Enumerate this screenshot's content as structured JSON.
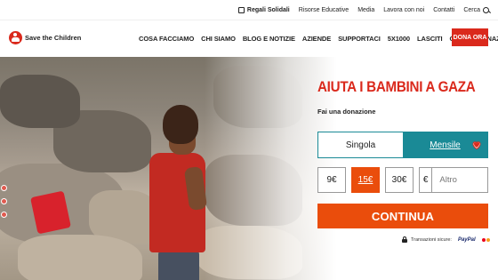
{
  "topbar": {
    "items": [
      "Regali Solidali",
      "Risorse Educative",
      "Media",
      "Lavora con noi",
      "Contatti",
      "Cerca"
    ]
  },
  "brand": {
    "name": "Save the Children",
    "color": "#da291c"
  },
  "nav": {
    "items": [
      "COSA FACCIAMO",
      "CHI SIAMO",
      "BLOG E NOTIZIE",
      "AZIENDE",
      "SUPPORTACI",
      "5X1000",
      "LASCITI",
      "GRANDI DONAZIONI"
    ],
    "donate": "DONA ORA"
  },
  "hero": {
    "title": "AIUTA I BAMBINI A GAZA",
    "subtitle": "Fai una donazione"
  },
  "donation": {
    "frequency": [
      {
        "label": "Singola",
        "selected": false
      },
      {
        "label": "Mensile",
        "selected": true
      }
    ],
    "amounts": [
      {
        "label": "9€",
        "selected": false
      },
      {
        "label": "15€",
        "selected": true
      },
      {
        "label": "30€",
        "selected": false
      }
    ],
    "currency_symbol": "€",
    "other_placeholder": "Altro",
    "continue": "CONTINUA",
    "secure_text": "Transazioni sicure:",
    "payment": "PayPal"
  },
  "colors": {
    "accent": "#ea4d0c",
    "teal": "#1a8a96",
    "red": "#da291c"
  },
  "icons": [
    "gift-bag-icon",
    "search-icon",
    "heart-icon",
    "lock-icon",
    "card-icon"
  ]
}
